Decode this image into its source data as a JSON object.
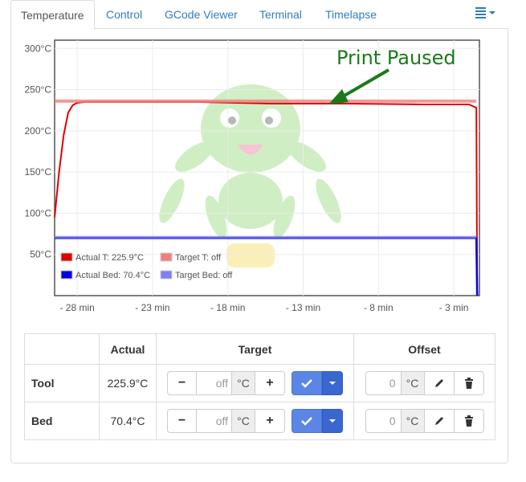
{
  "tabs": [
    {
      "label": "Temperature",
      "active": true
    },
    {
      "label": "Control"
    },
    {
      "label": "GCode Viewer"
    },
    {
      "label": "Terminal"
    },
    {
      "label": "Timelapse"
    }
  ],
  "menu_icon": "list-icon",
  "chart_data": {
    "type": "line",
    "y_ticks": [
      "300°C",
      "250°C",
      "200°C",
      "150°C",
      "100°C",
      "50°C"
    ],
    "x_ticks": [
      "- 28 min",
      "- 23 min",
      "- 18 min",
      "- 13 min",
      "- 8 min",
      "- 3 min"
    ],
    "xlim": [
      -29.5,
      -1.3
    ],
    "ylim": [
      0,
      310
    ],
    "grid": true,
    "legend_placement": "bottom-left",
    "series": [
      {
        "name": "Actual T: 225.9°C",
        "color": "#e00000",
        "x": [
          -29.5,
          -29.2,
          -28.9,
          -28.6,
          -28.3,
          -28.0,
          -27.5,
          -26.0,
          -20.0,
          -15.0,
          -10.0,
          -5.0,
          -2.0,
          -1.5,
          -1.45
        ],
        "y": [
          95,
          150,
          195,
          222,
          231,
          234,
          235,
          235,
          235,
          233,
          233,
          232,
          232,
          228,
          0
        ]
      },
      {
        "name": "Target T: off",
        "color": "#f08080",
        "x": [
          -29.5,
          -1.5
        ],
        "y": [
          236,
          236
        ]
      },
      {
        "name": "Actual Bed: 70.4°C",
        "color": "#0000e0",
        "x": [
          -29.5,
          -1.5,
          -1.45
        ],
        "y": [
          70,
          70,
          0
        ]
      },
      {
        "name": "Target Bed: off",
        "color": "#8080f0",
        "x": [
          -29.5,
          -1.5
        ],
        "y": [
          71,
          71
        ]
      }
    ],
    "annotation": "Print Paused"
  },
  "table": {
    "headers": [
      "",
      "Actual",
      "Target",
      "Offset"
    ],
    "rows": [
      {
        "name": "Tool",
        "actual": "225.9°C",
        "target_placeholder": "off",
        "unit": "°C",
        "offset_placeholder": "0"
      },
      {
        "name": "Bed",
        "actual": "70.4°C",
        "target_placeholder": "off",
        "unit": "°C",
        "offset_placeholder": "0"
      }
    ],
    "minus_label": "−",
    "plus_label": "+",
    "set_icon": "check-icon",
    "dropdown_icon": "caret-down-icon",
    "edit_icon": "pencil-icon",
    "delete_icon": "trash-icon"
  }
}
